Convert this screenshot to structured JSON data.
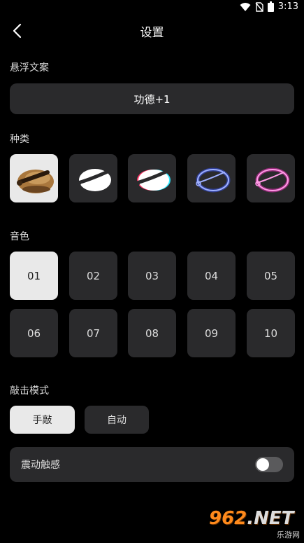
{
  "status_bar": {
    "time": "3:13"
  },
  "header": {
    "title": "设置"
  },
  "float_text": {
    "label": "悬浮文案",
    "value": "功德+1"
  },
  "types": {
    "label": "种类",
    "selected_index": 0
  },
  "sounds": {
    "label": "音色",
    "items": [
      "01",
      "02",
      "03",
      "04",
      "05",
      "06",
      "07",
      "08",
      "09",
      "10"
    ],
    "selected_index": 0
  },
  "mode": {
    "label": "敲击模式",
    "manual": "手敲",
    "auto": "自动",
    "selected": "手敲"
  },
  "vibration": {
    "label": "震动触感",
    "enabled": false
  },
  "watermark": {
    "brand": "962",
    "net": ".NET",
    "sub": "乐游网"
  },
  "colors": {
    "background": "#000000",
    "tile": "#2a2a2c",
    "selected": "#e9e9e9",
    "neon_blue": "#4a6cff",
    "neon_pink": "#ff3fd0"
  }
}
